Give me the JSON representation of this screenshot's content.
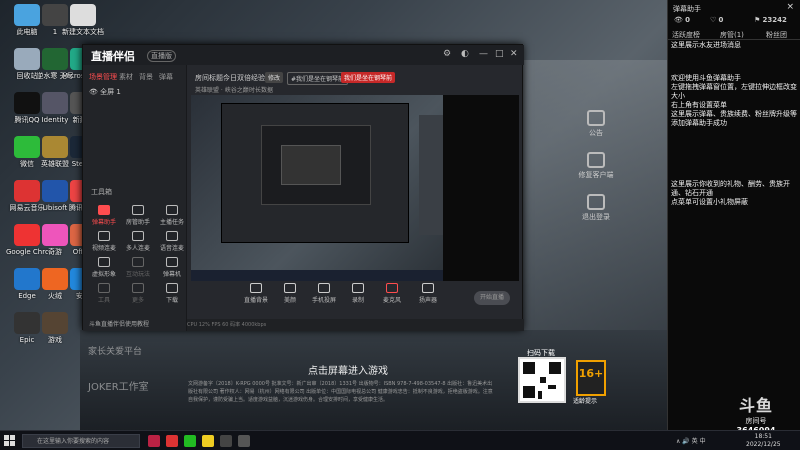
{
  "desktop_icons": [
    {
      "label": "此电脑",
      "color": "#4aa3df"
    },
    {
      "label": "1",
      "color": "#444"
    },
    {
      "label": "新建文本文档",
      "color": "#ddd"
    },
    {
      "label": "回收站",
      "color": "#9ab"
    },
    {
      "label": "逆水寒 无尽",
      "color": "#263"
    },
    {
      "label": "Microsoft Edge",
      "color": "#2a8"
    },
    {
      "label": "腾讯QQ",
      "color": "#111"
    },
    {
      "label": "Identity",
      "color": "#556"
    },
    {
      "label": "新建...",
      "color": "#555"
    },
    {
      "label": "微信",
      "color": "#2dbb3a"
    },
    {
      "label": "英雄联盟",
      "color": "#a83"
    },
    {
      "label": "Steam",
      "color": "#1b2838"
    },
    {
      "label": "网易云音乐",
      "color": "#d33"
    },
    {
      "label": "Ubisoft",
      "color": "#25a"
    },
    {
      "label": "腾讯游戏",
      "color": "#e44"
    },
    {
      "label": "Google Chrome",
      "color": "#e33"
    },
    {
      "label": "奇游",
      "color": "#e5b"
    },
    {
      "label": "Office",
      "color": "#d64"
    },
    {
      "label": "Edge",
      "color": "#27c"
    },
    {
      "label": "火绒",
      "color": "#e62"
    },
    {
      "label": "安全",
      "color": "#28d"
    },
    {
      "label": "Epic",
      "color": "#333"
    },
    {
      "label": "游戏",
      "color": "#543"
    }
  ],
  "app": {
    "brand": "直播伴侣",
    "brand_tag": "直播版",
    "side_tabs": [
      "场景管理",
      "素材",
      "背景",
      "弹幕"
    ],
    "scene_name": "全屏 1",
    "tools_title": "工具箱",
    "tools": [
      {
        "label": "弹幕助手",
        "red": true,
        "dim": false
      },
      {
        "label": "房管助手",
        "red": false,
        "dim": false
      },
      {
        "label": "主播任务",
        "red": false,
        "dim": false
      },
      {
        "label": "视频连麦",
        "red": false,
        "dim": false
      },
      {
        "label": "多人连麦",
        "red": false,
        "dim": false
      },
      {
        "label": "语音连麦",
        "red": false,
        "dim": false
      },
      {
        "label": "虚拟形象",
        "red": false,
        "dim": false
      },
      {
        "label": "互动玩法",
        "red": false,
        "dim": true
      },
      {
        "label": "弹幕机",
        "red": false,
        "dim": false
      },
      {
        "label": "工具",
        "red": false,
        "dim": true
      },
      {
        "label": "更多",
        "red": false,
        "dim": true
      },
      {
        "label": "下载",
        "red": false,
        "dim": false
      }
    ],
    "notice": "斗鱼直播伴侣使用教程",
    "room_title": "今日双倍经验",
    "room_title_prefix": "房间标题：",
    "edit_label": "修改",
    "category_pill": "#我们是坐在钢琴前",
    "category_pill2": "我们是坐在钢琴前",
    "category_line": "英雄联盟 · 峡谷之巅",
    "live_time": "时长数据",
    "controls": [
      "直播背景",
      "美颜",
      "手机投屏",
      "录制",
      "麦克风",
      "扬声器"
    ],
    "start_label": "开始直播",
    "status": "CPU 12%   FPS 60   码率 4000kbps"
  },
  "game": {
    "caption": "点击屏幕进入游戏",
    "license": "文网游备字〔2018〕K-RPG 0000号  批准文号：新广出审〔2018〕1331号  出版物号：ISBN 978-7-498-03547-8  出版社：鲁迅美术出版社有限公司  著作权人：网易（杭州）网络有限公司  出版单位：中国国际电视总公司  健康游戏忠告：抵制不良游戏，拒绝盗版游戏。注意自我保护，谨防受骗上当。适度游戏益脑，沉迷游戏伤身。合理安排时间，享受健康生活。",
    "qr_label": "扫码下载",
    "age": "16+",
    "age_tip": "适龄提示",
    "left_logo": "家长关爱平台",
    "joker": "JOKER工作室",
    "side_icons": [
      "公告",
      "修复客户端",
      "退出登录"
    ]
  },
  "danmu": {
    "title": "弹幕助手",
    "close": "×",
    "stats": [
      {
        "icon": "eye",
        "value": "0"
      },
      {
        "icon": "heart",
        "value": "0"
      },
      {
        "icon": "gift",
        "value": "23242"
      }
    ],
    "tabs": [
      "活跃度榜",
      "房管(1)",
      "粉丝团"
    ],
    "messages": [
      "这里展示水友进场消息",
      "欢迎使用斗鱼弹幕助手\n左键拖拽弹幕窗位置，左键拉伸边框改变大小\n右上角有设置菜单\n这里展示弹幕、贵族续费、粉丝牌升级等\n添加弹幕助手成功",
      "这里展示你收到的礼物、酬劳、贵族开通、钻石开通\n点菜单可设置小礼物屏蔽"
    ]
  },
  "douyu": {
    "name": "斗鱼",
    "room_label": "房间号",
    "room_id": "3646094"
  },
  "taskbar": {
    "search_placeholder": "在这里输入你要搜索的内容",
    "tray": "∧ 🔊 英 中",
    "time": "18:51",
    "date": "2022/12/25"
  }
}
